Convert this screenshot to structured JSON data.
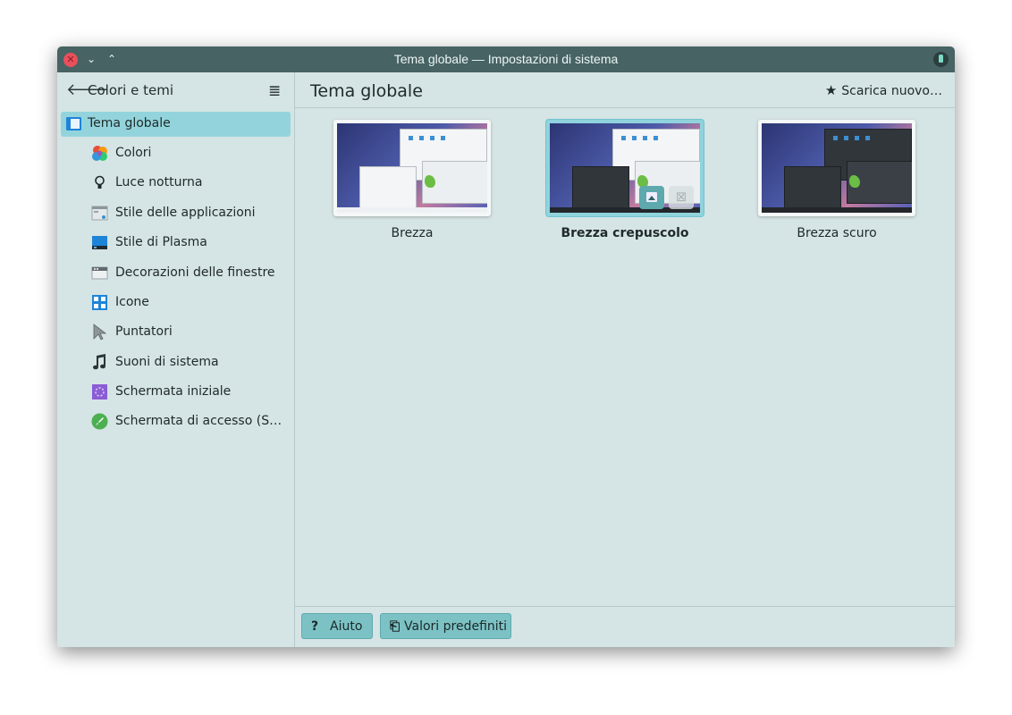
{
  "window": {
    "title": "Tema globale — Impostazioni di sistema",
    "controls": [
      "close-icon",
      "minimize-icon",
      "maximize-icon"
    ]
  },
  "sidebar": {
    "back_icon": "arrow-left-icon",
    "title": "Colori e temi",
    "menu_icon": "hamburger-menu-icon",
    "items": [
      {
        "label": "Tema globale",
        "icon": "global-theme-icon",
        "selected": true
      },
      {
        "label": "Colori",
        "icon": "colors-icon"
      },
      {
        "label": "Luce notturna",
        "icon": "lightbulb-icon"
      },
      {
        "label": "Stile delle applicazioni",
        "icon": "application-style-icon"
      },
      {
        "label": "Stile di Plasma",
        "icon": "plasma-style-icon"
      },
      {
        "label": "Decorazioni delle finestre",
        "icon": "window-decorations-icon"
      },
      {
        "label": "Icone",
        "icon": "icons-icon"
      },
      {
        "label": "Puntatori",
        "icon": "cursor-icon"
      },
      {
        "label": "Suoni di sistema",
        "icon": "music-note-icon"
      },
      {
        "label": "Schermata iniziale",
        "icon": "splash-screen-icon"
      },
      {
        "label": "Schermata di accesso (S…",
        "icon": "rocket-icon"
      }
    ]
  },
  "main": {
    "title": "Tema globale",
    "get_new_label": "Scarica nuovo…",
    "themes": [
      {
        "name": "Brezza",
        "variant": "light",
        "selected": false
      },
      {
        "name": "Brezza crepuscolo",
        "variant": "mix",
        "selected": true
      },
      {
        "name": "Brezza scuro",
        "variant": "dark",
        "selected": false
      }
    ]
  },
  "footer": {
    "help_icon": "?",
    "help_label": "Aiuto",
    "defaults_label": "Valori predefiniti"
  },
  "colors": {
    "titlebar": "#476363",
    "background": "#d5e4e4",
    "selection": "#93d4dc",
    "button": "#7cc2c5",
    "close": "#e8505b"
  }
}
